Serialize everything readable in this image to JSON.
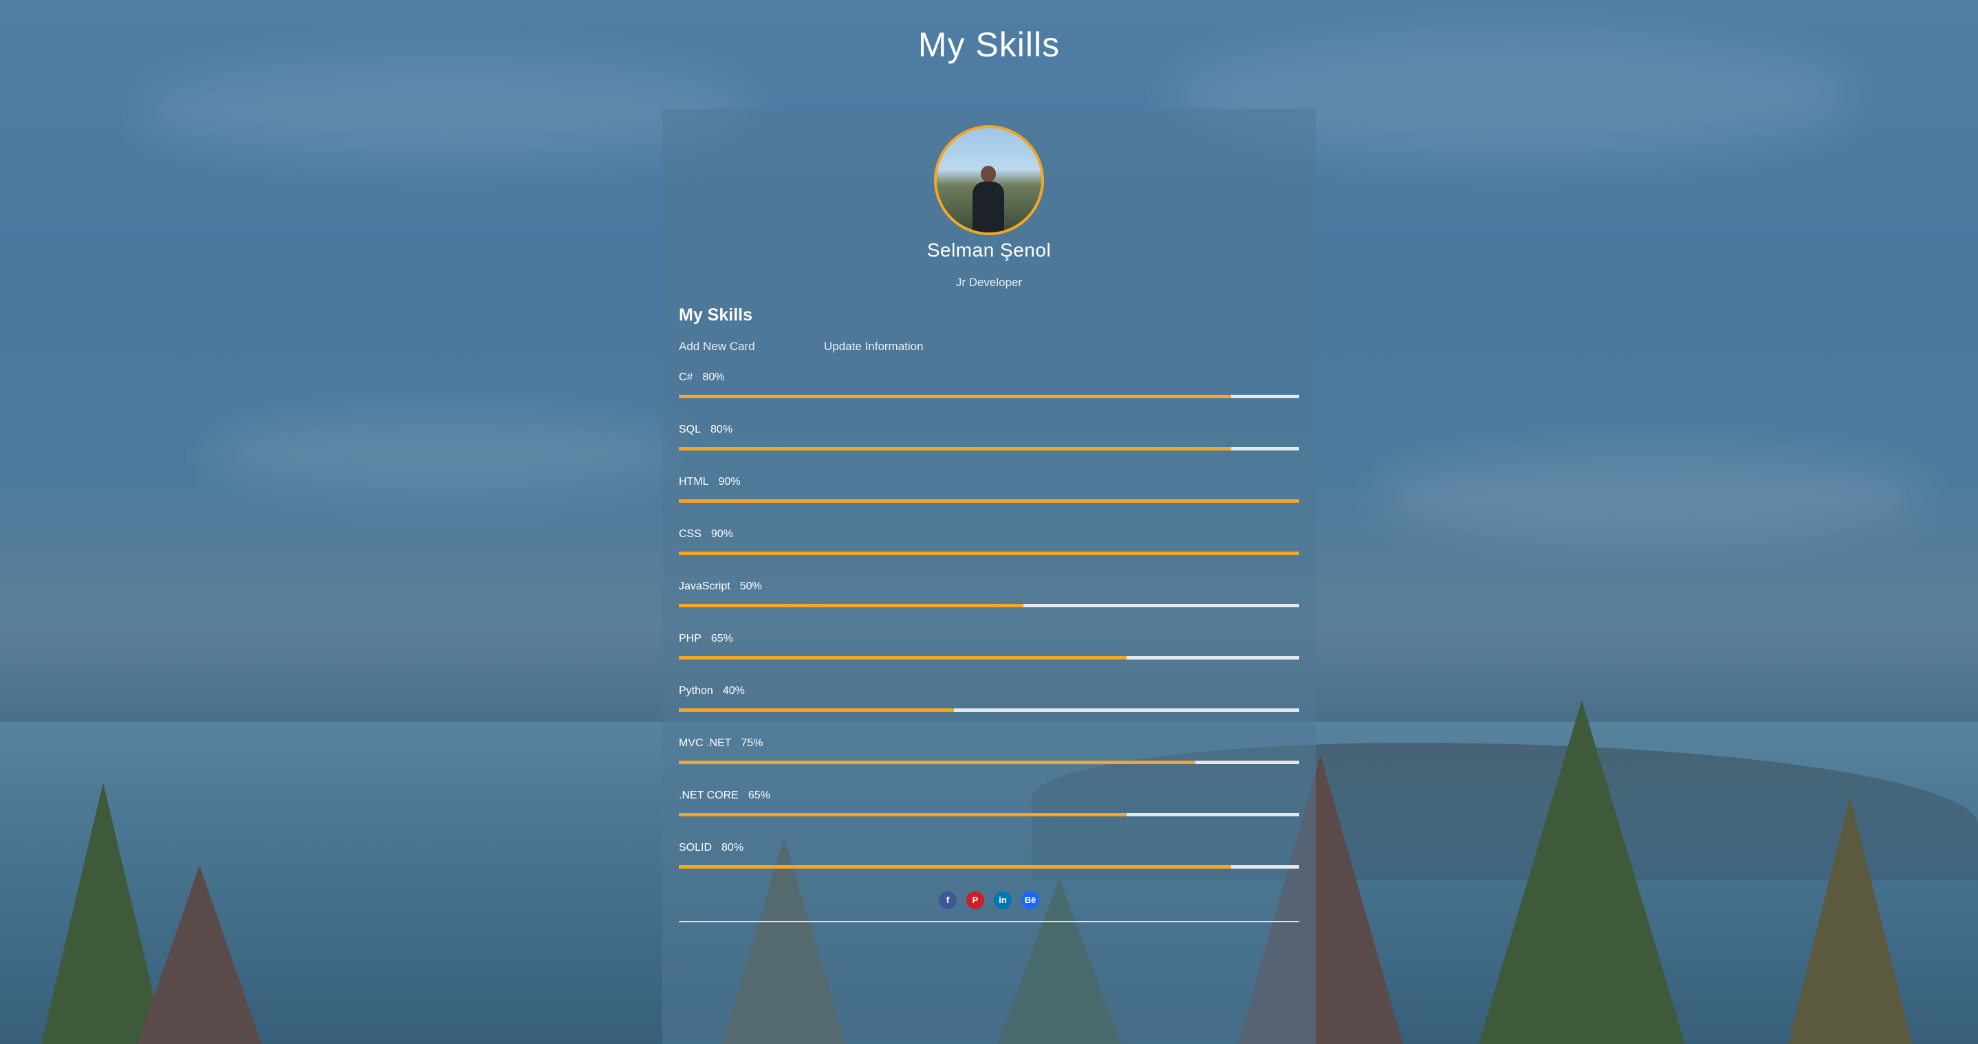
{
  "page": {
    "title": "My Skills"
  },
  "profile": {
    "name": "Selman Şenol",
    "role": "Jr Developer"
  },
  "skills_section": {
    "title": "My Skills",
    "add_label": "Add New Card",
    "update_label": "Update Information",
    "items": [
      {
        "name": "C#",
        "percent": "80%",
        "bar_fill_fraction": 0.89
      },
      {
        "name": "SQL",
        "percent": "80%",
        "bar_fill_fraction": 0.89
      },
      {
        "name": "HTML",
        "percent": "90%",
        "bar_fill_fraction": 1.0
      },
      {
        "name": "CSS",
        "percent": "90%",
        "bar_fill_fraction": 1.0
      },
      {
        "name": "JavaScript",
        "percent": "50%",
        "bar_fill_fraction": 0.555
      },
      {
        "name": "PHP",
        "percent": "65%",
        "bar_fill_fraction": 0.722
      },
      {
        "name": "Python",
        "percent": "40%",
        "bar_fill_fraction": 0.444
      },
      {
        "name": "MVC .NET",
        "percent": "75%",
        "bar_fill_fraction": 0.833
      },
      {
        "name": ".NET CORE",
        "percent": "65%",
        "bar_fill_fraction": 0.722
      },
      {
        "name": "SOLID",
        "percent": "80%",
        "bar_fill_fraction": 0.89
      }
    ]
  },
  "socials": [
    {
      "icon": "facebook-icon",
      "glyph": "f",
      "color": "#3b5998"
    },
    {
      "icon": "pinterest-icon",
      "glyph": "P",
      "color": "#cb2027"
    },
    {
      "icon": "linkedin-icon",
      "glyph": "in",
      "color": "#0077b5"
    },
    {
      "icon": "behance-icon",
      "glyph": "Bē",
      "color": "#1769ff"
    }
  ],
  "colors": {
    "accent": "#f5a623",
    "track": "#e6e9ec"
  }
}
